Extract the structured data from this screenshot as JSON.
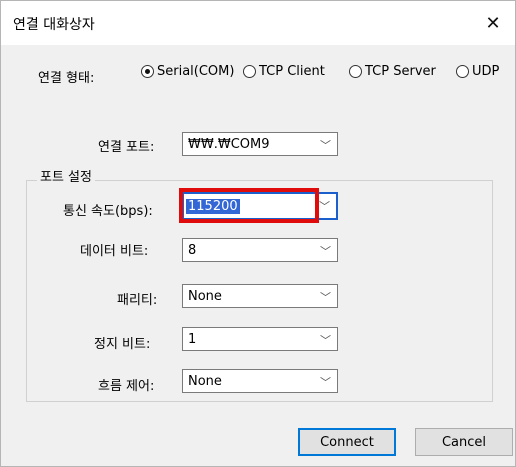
{
  "window": {
    "title": "연결 대화상자",
    "close_glyph": "✕"
  },
  "connection_type": {
    "label": "연결 형태:",
    "options": [
      {
        "label": "Serial(COM)",
        "selected": true
      },
      {
        "label": "TCP Client",
        "selected": false
      },
      {
        "label": "TCP Server",
        "selected": false
      },
      {
        "label": "UDP",
        "selected": false
      }
    ]
  },
  "port": {
    "label": "연결 포트:",
    "value": "₩₩.₩COM9"
  },
  "port_settings": {
    "group_title": "포트 설정",
    "baud": {
      "label": "통신 속도(bps):",
      "value": "115200"
    },
    "data_bits": {
      "label": "데이터 비트:",
      "value": "8"
    },
    "parity": {
      "label": "패리티:",
      "value": "None"
    },
    "stop_bits": {
      "label": "정지 비트:",
      "value": "1"
    },
    "flow_control": {
      "label": "흐름 제어:",
      "value": "None"
    }
  },
  "buttons": {
    "connect": "Connect",
    "cancel": "Cancel"
  },
  "icons": {
    "dropdown": "chevron-down-icon",
    "close": "close-icon"
  },
  "colors": {
    "highlight": "#e00b0b",
    "focus": "#1a5fcc",
    "selection": "#3367d6"
  }
}
